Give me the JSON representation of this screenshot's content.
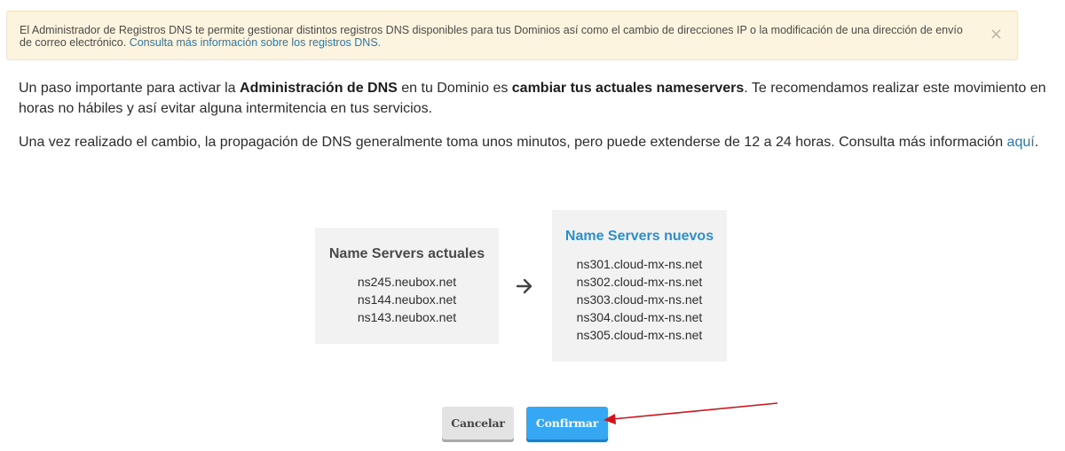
{
  "alert": {
    "text": "El Administrador de Registros DNS te permite gestionar distintos registros DNS disponibles para tus Dominios así como el cambio de direcciones IP o la modificación de una dirección de envío de correo electrónico.",
    "link": "Consulta más información sobre los registros DNS.",
    "close": "×"
  },
  "intro": {
    "part1": "Un paso importante para activar la ",
    "bold1": "Administración de DNS",
    "part2": " en tu Dominio es ",
    "bold2": "cambiar tus actuales nameservers",
    "part3": ". Te recomendamos realizar este movimiento en horas no hábiles y así evitar alguna intermitencia en tus servicios."
  },
  "propagation": {
    "text": "Una vez realizado el cambio, la propagación de DNS generalmente toma unos minutos, pero puede extenderse de 12 a 24 horas. Consulta más información ",
    "link": "aquí",
    "end": "."
  },
  "current": {
    "title": "Name Servers actuales",
    "servers": [
      "ns245.neubox.net",
      "ns144.neubox.net",
      "ns143.neubox.net"
    ]
  },
  "new": {
    "title": "Name Servers nuevos",
    "servers": [
      "ns301.cloud-mx-ns.net",
      "ns302.cloud-mx-ns.net",
      "ns303.cloud-mx-ns.net",
      "ns304.cloud-mx-ns.net",
      "ns305.cloud-mx-ns.net"
    ]
  },
  "buttons": {
    "cancel": "Cancelar",
    "confirm": "Confirmar"
  },
  "colors": {
    "accent": "#2f8dc9",
    "confirm": "#35a7f3",
    "annotation_arrow": "#d0141b"
  },
  "icons": {
    "arrow": "arrow-right-icon",
    "close": "close-icon"
  }
}
